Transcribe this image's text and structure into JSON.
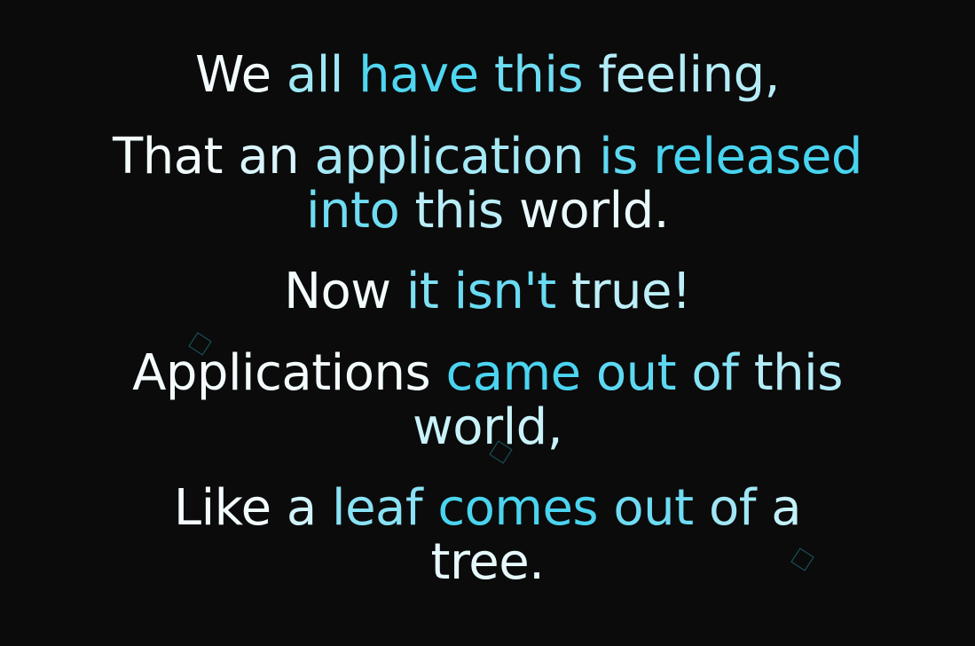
{
  "colors": {
    "background": "#0b0b0b",
    "deco_outline": "#1f6f7a",
    "gradient": [
      "#f4fbfd",
      "#e3f7fb",
      "#c6f1f9",
      "#a2e8f6",
      "#7fe0f4",
      "#5cd8f2",
      "#3fd0ef"
    ]
  },
  "stanzas": [
    {
      "words": [
        "We",
        "all",
        "have",
        "this",
        "feeling,"
      ]
    },
    {
      "words": [
        "That",
        "an",
        "application",
        "is",
        "released",
        "into",
        "this",
        "world."
      ]
    },
    {
      "words": [
        "Now",
        "it",
        "isn't",
        "true!"
      ]
    },
    {
      "words": [
        "Applications",
        "came",
        "out",
        "of",
        "this",
        "world,"
      ]
    },
    {
      "words": [
        "Like",
        "a",
        "leaf",
        "comes",
        "out",
        "of",
        "a",
        "tree."
      ]
    }
  ],
  "word_colors": [
    [
      "#f3fbfd",
      "#9fe7f5",
      "#4fd6f1",
      "#6edcf3",
      "#b4edf8"
    ],
    [
      "#f3fbfd",
      "#d9f5fb",
      "#a6e9f6",
      "#5ed8f2",
      "#48d4f0",
      "#6fdcf3",
      "#b9eef8",
      "#e9f9fc"
    ],
    [
      "#f3fbfd",
      "#7fe0f4",
      "#69dbf3",
      "#bdeff8"
    ],
    [
      "#f3fbfd",
      "#4ad4f0",
      "#5ed8f2",
      "#86e2f5",
      "#b4edf8",
      "#c9f2f9"
    ],
    [
      "#f3fbfd",
      "#d0f3fa",
      "#8ae2f5",
      "#4ad4f0",
      "#6edcf3",
      "#9fe7f5",
      "#c3f0f9",
      "#e6f8fc"
    ]
  ]
}
